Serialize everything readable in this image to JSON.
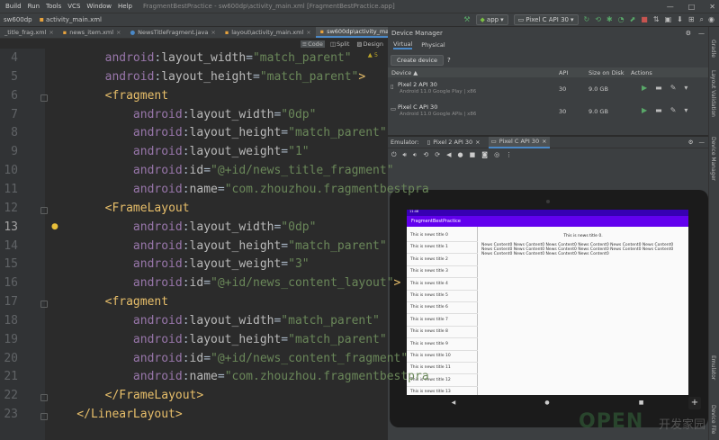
{
  "window": {
    "menu": [
      "Build",
      "Run",
      "Tools",
      "VCS",
      "Window",
      "Help"
    ],
    "title": "FragmentBestPractice - sw600dp\\activity_main.xml [FragmentBestPractice.app]",
    "controls": [
      "—",
      "□",
      "✕"
    ]
  },
  "toolbar": {
    "crumb_dir": "sw600dp",
    "crumb_file": "activity_main.xml",
    "run_config": "app",
    "device": "Pixel C API 30"
  },
  "tabs": [
    {
      "label": "_title_frag.xml",
      "active": false
    },
    {
      "label": "news_item.xml",
      "active": false
    },
    {
      "label": "NewsTitleFragment.java",
      "active": false
    },
    {
      "label": "layout\\activity_main.xml",
      "active": false
    },
    {
      "label": "sw600dp\\activity_main.xml",
      "active": true
    }
  ],
  "view_modes": {
    "code": "Code",
    "split": "Split",
    "design": "Design"
  },
  "editor": {
    "warnings": "▲ 5",
    "lines": [
      {
        "n": "4",
        "tokens": [
          [
            "ns",
            "        android"
          ],
          [
            "p",
            ":"
          ],
          [
            "attr",
            "layout_width"
          ],
          [
            "p",
            "="
          ],
          [
            "str",
            "\"match_parent\""
          ]
        ]
      },
      {
        "n": "5",
        "tokens": [
          [
            "ns",
            "        android"
          ],
          [
            "p",
            ":"
          ],
          [
            "attr",
            "layout_height"
          ],
          [
            "p",
            "="
          ],
          [
            "str",
            "\"match_parent\""
          ],
          [
            "br",
            ">"
          ]
        ]
      },
      {
        "n": "6",
        "tokens": [
          [
            "br",
            "        <"
          ],
          [
            "tag",
            "fragment"
          ]
        ]
      },
      {
        "n": "7",
        "tokens": [
          [
            "ns",
            "            android"
          ],
          [
            "p",
            ":"
          ],
          [
            "attr",
            "layout_width"
          ],
          [
            "p",
            "="
          ],
          [
            "str",
            "\"0dp\""
          ]
        ]
      },
      {
        "n": "8",
        "tokens": [
          [
            "ns",
            "            android"
          ],
          [
            "p",
            ":"
          ],
          [
            "attr",
            "layout_height"
          ],
          [
            "p",
            "="
          ],
          [
            "str",
            "\"match_parent\""
          ]
        ]
      },
      {
        "n": "9",
        "tokens": [
          [
            "ns",
            "            android"
          ],
          [
            "p",
            ":"
          ],
          [
            "attr",
            "layout_weight"
          ],
          [
            "p",
            "="
          ],
          [
            "str",
            "\"1\""
          ]
        ]
      },
      {
        "n": "10",
        "tokens": [
          [
            "ns",
            "            android"
          ],
          [
            "p",
            ":"
          ],
          [
            "attr",
            "id"
          ],
          [
            "p",
            "="
          ],
          [
            "str",
            "\"@+id/news_title_fragment\""
          ]
        ]
      },
      {
        "n": "11",
        "tokens": [
          [
            "ns",
            "            android"
          ],
          [
            "p",
            ":"
          ],
          [
            "attr",
            "name"
          ],
          [
            "p",
            "="
          ],
          [
            "str",
            "\"com.zhouzhou.fragmentbestpra"
          ]
        ]
      },
      {
        "n": "12",
        "tokens": [
          [
            "br",
            "        <"
          ],
          [
            "tag",
            "FrameLayout"
          ]
        ]
      },
      {
        "n": "13",
        "tokens": [
          [
            "ns",
            "            android"
          ],
          [
            "p",
            ":"
          ],
          [
            "attr",
            "layout_width"
          ],
          [
            "p",
            "="
          ],
          [
            "str",
            "\"0dp\""
          ]
        ]
      },
      {
        "n": "14",
        "tokens": [
          [
            "ns",
            "            android"
          ],
          [
            "p",
            ":"
          ],
          [
            "attr",
            "layout_height"
          ],
          [
            "p",
            "="
          ],
          [
            "str",
            "\"match_parent\""
          ]
        ]
      },
      {
        "n": "15",
        "tokens": [
          [
            "ns",
            "            android"
          ],
          [
            "p",
            ":"
          ],
          [
            "attr",
            "layout_weight"
          ],
          [
            "p",
            "="
          ],
          [
            "str",
            "\"3\""
          ]
        ]
      },
      {
        "n": "16",
        "tokens": [
          [
            "ns",
            "            android"
          ],
          [
            "p",
            ":"
          ],
          [
            "attr",
            "id"
          ],
          [
            "p",
            "="
          ],
          [
            "str",
            "\"@+id/news_content_layout\""
          ],
          [
            "br",
            ">"
          ]
        ]
      },
      {
        "n": "17",
        "tokens": [
          [
            "br",
            "        <"
          ],
          [
            "tag",
            "fragment"
          ]
        ]
      },
      {
        "n": "18",
        "tokens": [
          [
            "ns",
            "            android"
          ],
          [
            "p",
            ":"
          ],
          [
            "attr",
            "layout_width"
          ],
          [
            "p",
            "="
          ],
          [
            "str",
            "\"match_parent\""
          ]
        ]
      },
      {
        "n": "19",
        "tokens": [
          [
            "ns",
            "            android"
          ],
          [
            "p",
            ":"
          ],
          [
            "attr",
            "layout_height"
          ],
          [
            "p",
            "="
          ],
          [
            "str",
            "\"match_parent\""
          ]
        ]
      },
      {
        "n": "20",
        "tokens": [
          [
            "ns",
            "            android"
          ],
          [
            "p",
            ":"
          ],
          [
            "attr",
            "id"
          ],
          [
            "p",
            "="
          ],
          [
            "str",
            "\"@+id/news_content_fragment\""
          ]
        ]
      },
      {
        "n": "21",
        "tokens": [
          [
            "ns",
            "            android"
          ],
          [
            "p",
            ":"
          ],
          [
            "attr",
            "name"
          ],
          [
            "p",
            "="
          ],
          [
            "str",
            "\"com.zhouzhou.fragmentbestpra"
          ]
        ]
      },
      {
        "n": "22",
        "tokens": [
          [
            "br",
            "        </"
          ],
          [
            "tag",
            "FrameLayout"
          ],
          [
            "br",
            ">"
          ]
        ]
      },
      {
        "n": "23",
        "tokens": [
          [
            "br",
            "    </"
          ],
          [
            "tag",
            "LinearLayout"
          ],
          [
            "br",
            ">"
          ]
        ]
      }
    ],
    "current_line": "13"
  },
  "device_manager": {
    "title": "Device Manager",
    "tabs": [
      "Virtual",
      "Physical"
    ],
    "create_label": "Create device",
    "help": "?",
    "columns": {
      "device": "Device ▲",
      "api": "API",
      "size": "Size on Disk",
      "actions": "Actions"
    },
    "devices": [
      {
        "name": "Pixel 2 API 30",
        "sub": "Android 11.0 Google Play | x86",
        "api": "30",
        "size": "9.0 GB"
      },
      {
        "name": "Pixel C API 30",
        "sub": "Android 11.0 Google APIs | x86",
        "api": "30",
        "size": "9.0 GB"
      }
    ]
  },
  "emulator": {
    "label": "Emulator:",
    "tabs": [
      "Pixel 2 API 30",
      "Pixel C API 30"
    ],
    "app_title": "FragmentBestPractice",
    "status_time": "11:46",
    "news_titles": [
      "This is news title 0",
      "This is news title 1",
      "This is news title 2",
      "This is news title 3",
      "This is news title 4",
      "This is news title 5",
      "This is news title 6",
      "This is news title 7",
      "This is news title 8",
      "This is news title 9",
      "This is news title 10",
      "This is news title 11",
      "This is news title 12",
      "This is news title 13"
    ],
    "content_title": "This is news title 0.",
    "content_body": "News Content0 News Content0 News Content0 News Content0 News Content0 News Content0 News Content0 News Content0 News Content0 News Content0 News Content0 News Content0 News Content0 News Content0 News Content0 News Content0"
  },
  "right_strip": [
    "Gradle",
    "Layout Validation",
    "Device Manager",
    "Emulator",
    "Device File"
  ],
  "watermark": {
    "latin": "OPEN",
    "cn": "开发家园"
  },
  "colors": {
    "keyword_ns": "#9876aa",
    "string": "#6a8759",
    "tag": "#e8bf6a",
    "accent": "#6200ee"
  }
}
